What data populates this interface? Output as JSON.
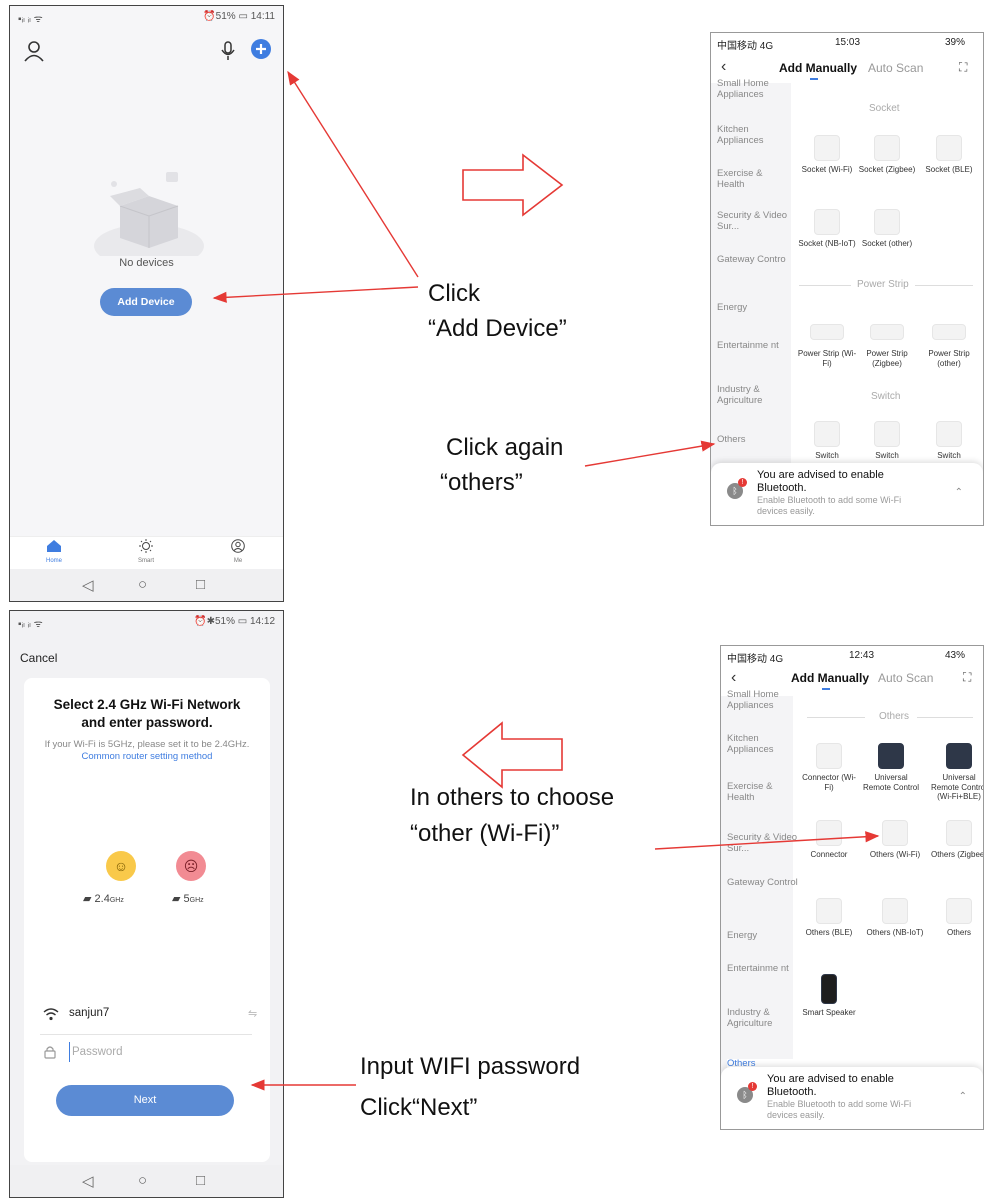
{
  "phone1": {
    "status_left": "▪ᵢₗ ᵢₗ ᯤ",
    "status_right": "⏰51% ▭ 14:11",
    "empty_text": "No devices",
    "add_device_label": "Add Device",
    "nav": [
      {
        "label": "Home",
        "icon": "home-icon"
      },
      {
        "label": "Smart",
        "icon": "sun-icon"
      },
      {
        "label": "Me",
        "icon": "user-circle-icon"
      }
    ]
  },
  "phone2": {
    "status_left": "▪ᵢₗ ᵢₗ ᯤ",
    "status_right": "⏰✱51% ▭ 14:12",
    "cancel_label": "Cancel",
    "title": "Select 2.4 GHz Wi-Fi Network and enter password.",
    "hint": "If your Wi-Fi is 5GHz, please set it to be 2.4GHz.",
    "hint_link": "Common router setting method",
    "band_24": "2.4",
    "band_24_unit": "GHz",
    "band_5": "5",
    "band_5_unit": "GHz",
    "wifi_name": "sanjun7",
    "password_placeholder": "Password",
    "next_label": "Next"
  },
  "ios1": {
    "carrier": "中国移动 4G",
    "time": "15:03",
    "battery": "39%",
    "tab_manual": "Add Manually",
    "tab_auto": "Auto Scan",
    "categories": [
      "Small Home Appliances",
      "Kitchen Appliances",
      "Exercise & Health",
      "Security & Video Sur...",
      "Gateway Contro",
      "Energy",
      "Entertainme nt",
      "Industry & Agriculture",
      "Others"
    ],
    "section_socket": "Socket",
    "sockets": [
      "Socket (Wi-Fi)",
      "Socket (Zigbee)",
      "Socket (BLE)",
      "Socket (NB-IoT)",
      "Socket (other)"
    ],
    "section_strip": "Power Strip",
    "strips": [
      "Power Strip (Wi-Fi)",
      "Power Strip (Zigbee)",
      "Power Strip (other)"
    ],
    "section_switch": "Switch",
    "switches": [
      "Switch",
      "Switch",
      "Switch"
    ],
    "bt_title": "You are advised to enable Bluetooth.",
    "bt_body": "Enable Bluetooth to add some Wi-Fi devices easily."
  },
  "ios2": {
    "carrier": "中国移动 4G",
    "time": "12:43",
    "battery": "43%",
    "tab_manual": "Add Manually",
    "tab_auto": "Auto Scan",
    "categories": [
      "Small Home Appliances",
      "Kitchen Appliances",
      "Exercise & Health",
      "Security & Video Sur...",
      "Gateway Control",
      "Energy",
      "Entertainme nt",
      "Industry & Agriculture",
      "Others"
    ],
    "section_others": "Others",
    "tiles": [
      "Connector (Wi-Fi)",
      "Universal Remote Control",
      "Universal Remote Control (Wi-Fi+BLE)",
      "Connector",
      "Others (Wi-Fi)",
      "Others (Zigbee)",
      "Others (BLE)",
      "Others (NB-IoT)",
      "Others",
      "Smart Speaker"
    ],
    "bt_title": "You are advised to enable Bluetooth.",
    "bt_body": "Enable Bluetooth to add some Wi-Fi devices easily."
  },
  "captions": {
    "click": "Click",
    "add_device": "“Add Device”",
    "click_again": "Click again",
    "others": "“others”",
    "in_others": "In others to choose",
    "other_wifi": "“other (Wi-Fi)”",
    "input_pw": "Input WIFI password",
    "click_next": "Click“Next”"
  },
  "colors": {
    "accent": "#5b8bd4",
    "arrow": "#e53935",
    "icon_blue": "#3f7de0"
  }
}
